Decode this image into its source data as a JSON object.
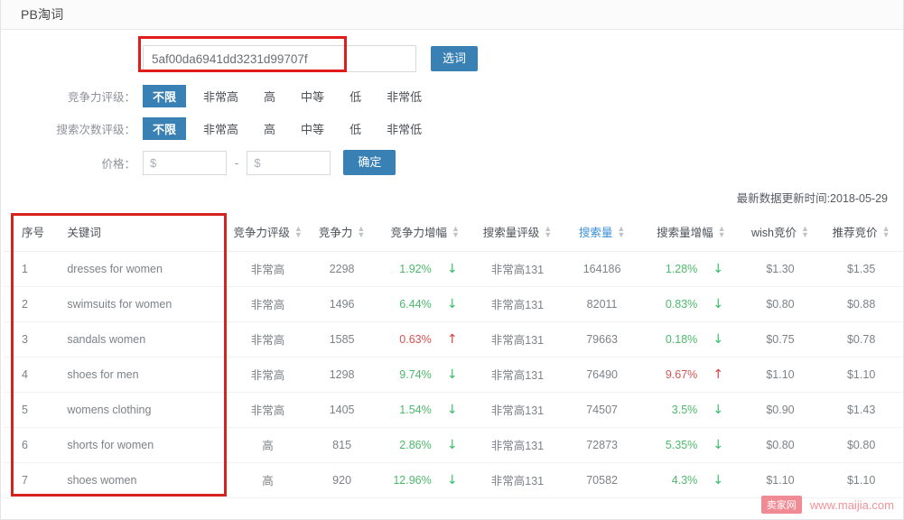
{
  "window": {
    "title": "PB淘词"
  },
  "filters": {
    "keyword": {
      "value": "5af00da6941dd3231d99707f",
      "placeholder": "",
      "button_label": "选词"
    },
    "competition_rating": {
      "label": "竞争力评级：",
      "options": [
        "不限",
        "非常高",
        "高",
        "中等",
        "低",
        "非常低"
      ],
      "selected": "不限"
    },
    "search_count_rating": {
      "label": "搜索次数评级：",
      "options": [
        "不限",
        "非常高",
        "高",
        "中等",
        "低",
        "非常低"
      ],
      "selected": "不限"
    },
    "price": {
      "label": "价格：",
      "min_placeholder": "$",
      "min_value": "",
      "max_placeholder": "$",
      "max_value": "",
      "separator": "-",
      "confirm_label": "确定"
    }
  },
  "update_stamp": "最新数据更新时间:2018-05-29",
  "table": {
    "sorted_column": "搜索量",
    "columns": [
      {
        "key": "idx",
        "label": "序号",
        "sortable": false
      },
      {
        "key": "kw",
        "label": "关键词",
        "sortable": false
      },
      {
        "key": "crate",
        "label": "竞争力评级",
        "sortable": true
      },
      {
        "key": "comp",
        "label": "竞争力",
        "sortable": true
      },
      {
        "key": "cgrow",
        "label": "竞争力增幅",
        "sortable": true
      },
      {
        "key": "srate",
        "label": "搜索量评级",
        "sortable": true
      },
      {
        "key": "svol",
        "label": "搜索量",
        "sortable": true
      },
      {
        "key": "sgrow",
        "label": "搜索量增幅",
        "sortable": true
      },
      {
        "key": "wbid",
        "label": "wish竞价",
        "sortable": true
      },
      {
        "key": "rbid",
        "label": "推荐竞价",
        "sortable": true
      }
    ],
    "rows": [
      {
        "idx": "1",
        "kw": "dresses for women",
        "crate": "非常高",
        "comp": "2298",
        "cgrow": "1.92%",
        "cgrow_dir": "down",
        "srate": "非常高131",
        "svol": "164186",
        "sgrow": "1.28%",
        "sgrow_dir": "down",
        "wbid": "$1.30",
        "rbid": "$1.35"
      },
      {
        "idx": "2",
        "kw": "swimsuits for women",
        "crate": "非常高",
        "comp": "1496",
        "cgrow": "6.44%",
        "cgrow_dir": "down",
        "srate": "非常高131",
        "svol": "82011",
        "sgrow": "0.83%",
        "sgrow_dir": "down",
        "wbid": "$0.80",
        "rbid": "$0.88"
      },
      {
        "idx": "3",
        "kw": "sandals women",
        "crate": "非常高",
        "comp": "1585",
        "cgrow": "0.63%",
        "cgrow_dir": "up",
        "srate": "非常高131",
        "svol": "79663",
        "sgrow": "0.18%",
        "sgrow_dir": "down",
        "wbid": "$0.75",
        "rbid": "$0.78"
      },
      {
        "idx": "4",
        "kw": "shoes for men",
        "crate": "非常高",
        "comp": "1298",
        "cgrow": "9.74%",
        "cgrow_dir": "down",
        "srate": "非常高131",
        "svol": "76490",
        "sgrow": "9.67%",
        "sgrow_dir": "up",
        "wbid": "$1.10",
        "rbid": "$1.10"
      },
      {
        "idx": "5",
        "kw": "womens clothing",
        "crate": "非常高",
        "comp": "1405",
        "cgrow": "1.54%",
        "cgrow_dir": "down",
        "srate": "非常高131",
        "svol": "74507",
        "sgrow": "3.5%",
        "sgrow_dir": "down",
        "wbid": "$0.90",
        "rbid": "$1.43"
      },
      {
        "idx": "6",
        "kw": "shorts for women",
        "crate": "高",
        "comp": "815",
        "cgrow": "2.86%",
        "cgrow_dir": "down",
        "srate": "非常高131",
        "svol": "72873",
        "sgrow": "5.35%",
        "sgrow_dir": "down",
        "wbid": "$0.80",
        "rbid": "$0.80"
      },
      {
        "idx": "7",
        "kw": "shoes women",
        "crate": "高",
        "comp": "920",
        "cgrow": "12.96%",
        "cgrow_dir": "down",
        "srate": "非常高131",
        "svol": "70582",
        "sgrow": "4.3%",
        "sgrow_dir": "down",
        "wbid": "$1.10",
        "rbid": "$1.10"
      }
    ]
  },
  "watermark": {
    "badge": "卖家网",
    "text": "www.maijia.com"
  },
  "colors": {
    "accent": "#3980b5",
    "annotation": "#e21b1b",
    "up": "#d6413f",
    "down": "#3bbf69",
    "sorted_header": "#3b8fd4"
  }
}
